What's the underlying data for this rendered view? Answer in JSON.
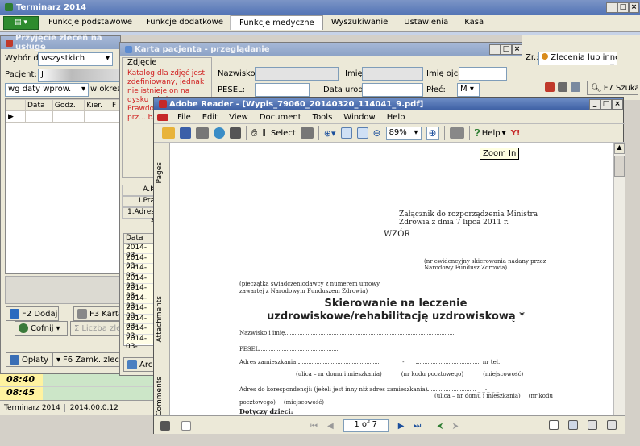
{
  "app": {
    "title": "Terminarz 2014"
  },
  "main_tabs": [
    "Funkcje podstawowe",
    "Funkcje dodatkowe",
    "Funkcje medyczne",
    "Wyszukiwanie",
    "Ustawienia",
    "Kasa"
  ],
  "orders_window": {
    "title": "Przyjęcie zleceń na usługę",
    "filter_label": "Wybór dla:",
    "filter_value": "wszystkich",
    "patient_label": "Pacjent:",
    "patient_value": "J",
    "sort_value": "wg daty wprow.",
    "period_label": "w okresie",
    "columns": [
      "Data",
      "Godz.",
      "Kier.",
      "F"
    ],
    "buttons": {
      "add": "F2 Dodaj",
      "card": "F3 Karta",
      "undo": "Cofnij",
      "count": "Liczba zle",
      "payments": "Opłaty",
      "close_orders": "F6 Zamk. zleceń"
    }
  },
  "patient_card": {
    "title": "Karta pacjenta - przeglądanie",
    "photo_group": "Zdjęcie",
    "photo_note": "Katalog dla zdjęć jest zdefiniowany, jednak nie istnieje on na dysku lokalnym Prawdop... zostać prz... bazą dan...",
    "fields": {
      "surname": "Nazwisko:",
      "name": "Imię:",
      "father": "Imię ojca:",
      "pesel": "PESEL:",
      "birth": "Data urodz.:",
      "sex": "Płeć:",
      "sex_value": "M"
    },
    "side_labels": [
      "A.K",
      "I.Pra",
      "1.Adres z"
    ],
    "date_column": "Data",
    "dates": [
      "2014-03-",
      "2014-03-",
      "2014-03-",
      "2014-03-",
      "2014-03-",
      "2014-03-",
      "2014-03-",
      "2014-03-",
      "2014-03-",
      "2014-03-"
    ],
    "archive_button": "Arch"
  },
  "right_panel": {
    "filter_suffix": "Zr.:",
    "filter_value": "Zlecenia lub inne",
    "search_button": "F7 Szukaj"
  },
  "time_slots": [
    "08:40",
    "08:45"
  ],
  "status_bar": {
    "app": "Terminarz 2014",
    "version": "2014.00.0.12"
  },
  "reader": {
    "title": "Adobe Reader - [Wypis_79060_20140320_114041_9.pdf]",
    "menu": [
      "File",
      "Edit",
      "View",
      "Document",
      "Tools",
      "Window",
      "Help"
    ],
    "select_label": "Select",
    "zoom": "89%",
    "help_label": "Help",
    "tooltip": "Zoom In",
    "side_tabs": [
      "Pages",
      "Attachments",
      "Comments"
    ],
    "page_indicator": "1 of 7",
    "doc": {
      "annex": "Załącznik do rozporządzenia  Ministra Zdrowia z dnia 7 lipca  2011 r.",
      "template": "WZÓR",
      "referral_number_note": "(nr ewidencyjny skierowania nadany przez Narodowy Fundusz Zdrowia)",
      "stamp_note": "(pieczątka świadczeniodawcy z numerem umowy zawartej z Narodowym Funduszem Zdrowia)",
      "heading": "Skierowanie na leczenie uzdrowiskowe/rehabilitację uzdrowiskową *",
      "surname_field": "Nazwisko i imię",
      "pesel_field": "PESEL",
      "address_field": "Adres zamieszkania:",
      "phone_field": "nr tel.",
      "street_note": "(ulica – nr domu i mieszkania)",
      "postcode_note": "(nr kodu pocztowego)",
      "city_note": "(miejscowość)",
      "postcode_mask": "_ _-_ _ _",
      "correspondence_field": "Adres do korespondencji: (jeżeli jest inny niż adres zamieszkania)",
      "correspondence_street_note": "(ulica – nr domu i mieszkania)",
      "nr_kodu": "(nr  kodu",
      "pocztowego": "pocztowego)",
      "concerns": "Dotyczy dzieci:"
    }
  }
}
